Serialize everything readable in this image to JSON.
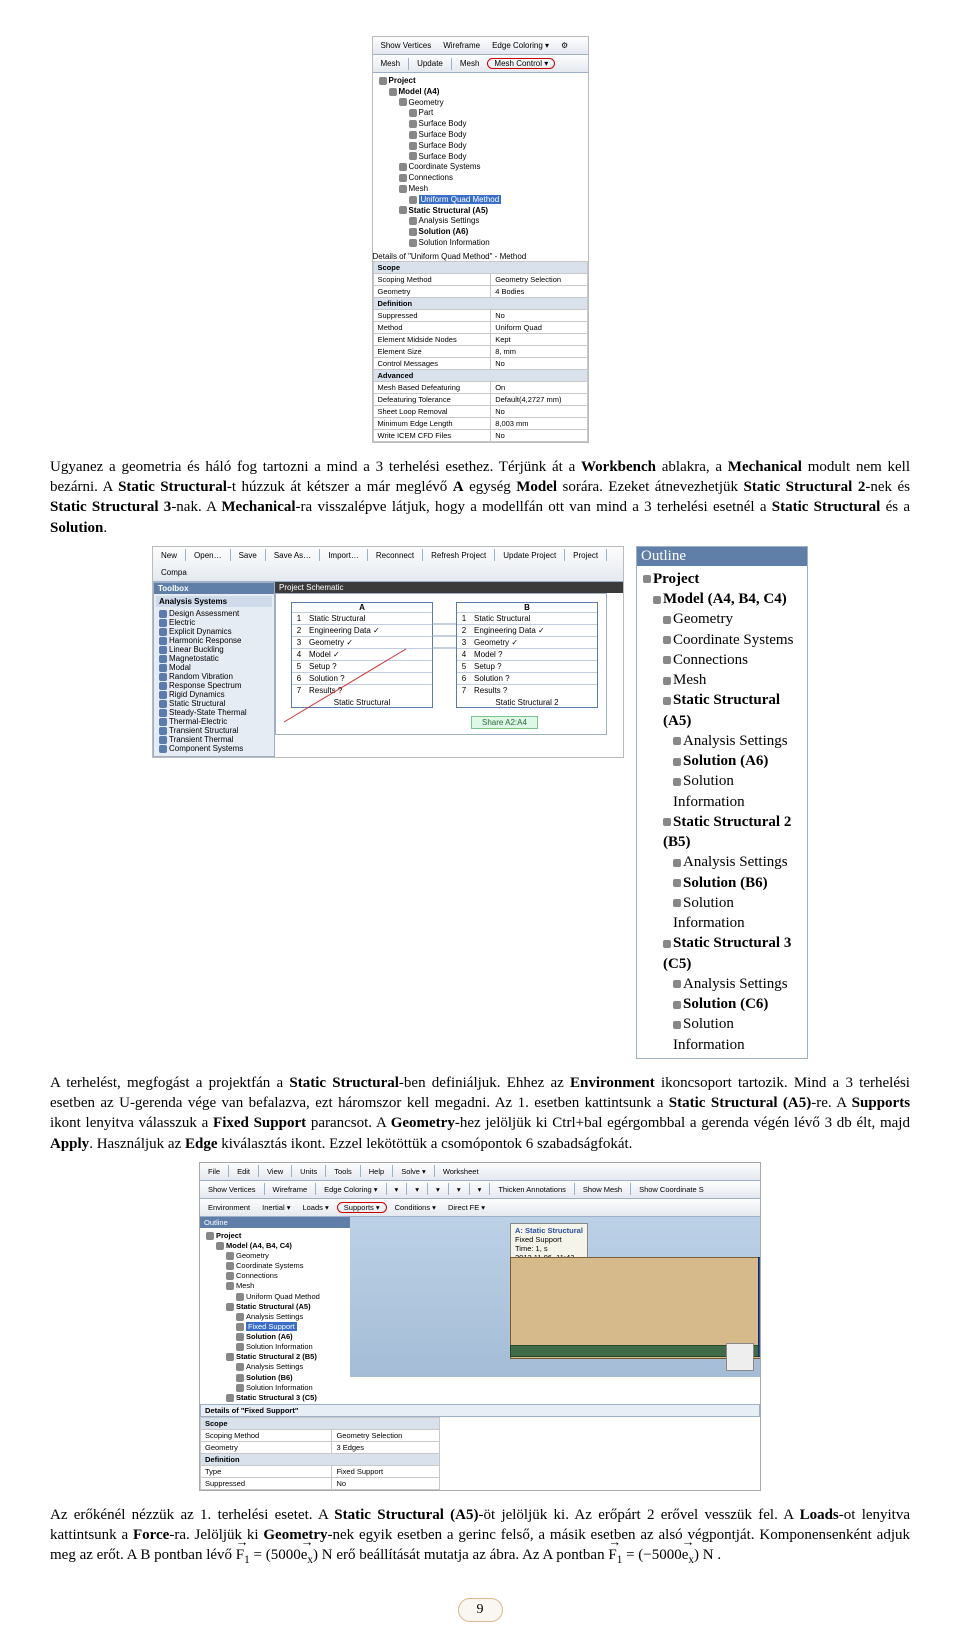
{
  "fig1": {
    "toolbar_row1": [
      "Show Vertices",
      "Wireframe",
      "Edge Coloring ▾",
      "⚙"
    ],
    "toolbar_row2": [
      "Mesh",
      "Update",
      "Mesh",
      "Mesh Control ▾"
    ],
    "tree_title": "Project",
    "tree": [
      {
        "lvl": 0,
        "txt": "Project",
        "bold": true
      },
      {
        "lvl": 1,
        "txt": "Model (A4)",
        "bold": true
      },
      {
        "lvl": 2,
        "txt": "Geometry"
      },
      {
        "lvl": 3,
        "txt": "Part"
      },
      {
        "lvl": 3,
        "txt": "Surface Body"
      },
      {
        "lvl": 3,
        "txt": "Surface Body"
      },
      {
        "lvl": 3,
        "txt": "Surface Body"
      },
      {
        "lvl": 3,
        "txt": "Surface Body"
      },
      {
        "lvl": 2,
        "txt": "Coordinate Systems"
      },
      {
        "lvl": 2,
        "txt": "Connections"
      },
      {
        "lvl": 2,
        "txt": "Mesh"
      },
      {
        "lvl": 3,
        "txt": "Uniform Quad Method",
        "sel": true
      },
      {
        "lvl": 2,
        "txt": "Static Structural (A5)",
        "bold": true
      },
      {
        "lvl": 3,
        "txt": "Analysis Settings"
      },
      {
        "lvl": 3,
        "txt": "Solution (A6)",
        "bold": true
      },
      {
        "lvl": 3,
        "txt": "Solution Information"
      }
    ],
    "detail_title": "Details of \"Uniform Quad Method\" - Method",
    "props": [
      {
        "hdr": "Scope"
      },
      {
        "k": "Scoping Method",
        "v": "Geometry Selection"
      },
      {
        "k": "Geometry",
        "v": "4 Bodies"
      },
      {
        "hdr": "Definition"
      },
      {
        "k": "Suppressed",
        "v": "No"
      },
      {
        "k": "Method",
        "v": "Uniform Quad"
      },
      {
        "k": "Element Midside Nodes",
        "v": "Kept"
      },
      {
        "k": "Element Size",
        "v": "8, mm"
      },
      {
        "k": "Control Messages",
        "v": "No"
      },
      {
        "hdr": "Advanced"
      },
      {
        "k": "Mesh Based Defeaturing",
        "v": "On"
      },
      {
        "k": "Defeaturing Tolerance",
        "v": "Default(4,2727 mm)"
      },
      {
        "k": "Sheet Loop Removal",
        "v": "No"
      },
      {
        "k": "Minimum Edge Length",
        "v": "8,003 mm"
      },
      {
        "k": "Write ICEM CFD Files",
        "v": "No"
      }
    ]
  },
  "para1_parts": {
    "a": "Ugyanez a geometria és háló fog tartozni a mind a 3 terhelési esethez. Térjünk át a ",
    "b": "Workbench",
    "c": " ablakra, a ",
    "d": "Mechanical",
    "e": " modult nem kell bezárni. A ",
    "f": "Static Structural",
    "g": "-t húzzuk át kétszer a már meglévő ",
    "h": "A",
    "i": " egység ",
    "j": "Model",
    "k": " sorára. Ezeket átnevezhetjük ",
    "l": "Static Structural 2",
    "m": "-nek és ",
    "n": "Static Structural 3",
    "o": "-nak. A ",
    "p": "Mechanical",
    "q": "-ra visszalépve látjuk, hogy a modellfán ott van mind a 3 terhelési esetnél a ",
    "r": "Static Structural",
    "s": " és a ",
    "t": "Solution",
    "u": "."
  },
  "fig2": {
    "toolbar": [
      "New",
      "Open…",
      "Save",
      "Save As…",
      "Import…",
      "Reconnect",
      "Refresh Project",
      "Update Project",
      "Project",
      "Compa"
    ],
    "toolbox_title": "Toolbox",
    "toolbox_group": "Analysis Systems",
    "toolbox_items": [
      "Design Assessment",
      "Electric",
      "Explicit Dynamics",
      "Harmonic Response",
      "Linear Buckling",
      "Magnetostatic",
      "Modal",
      "Random Vibration",
      "Response Spectrum",
      "Rigid Dynamics",
      "Static Structural",
      "Steady-State Thermal",
      "Thermal-Electric",
      "Transient Structural",
      "Transient Thermal",
      "Component Systems"
    ],
    "schematic_title": "Project Schematic",
    "cells": {
      "A": {
        "head": "A",
        "rows": [
          [
            "1",
            "Static Structural"
          ],
          [
            "2",
            "Engineering Data  ✓"
          ],
          [
            "3",
            "Geometry  ✓"
          ],
          [
            "4",
            "Model  ✓"
          ],
          [
            "5",
            "Setup  ?"
          ],
          [
            "6",
            "Solution  ?"
          ],
          [
            "7",
            "Results  ?"
          ]
        ],
        "cap": "Static Structural"
      },
      "B": {
        "head": "B",
        "rows": [
          [
            "1",
            "Static Structural"
          ],
          [
            "2",
            "Engineering Data  ✓"
          ],
          [
            "3",
            "Geometry  ✓"
          ],
          [
            "4",
            "Model  ?"
          ],
          [
            "5",
            "Setup  ?"
          ],
          [
            "6",
            "Solution  ?"
          ],
          [
            "7",
            "Results  ?"
          ]
        ],
        "cap": "Static Structural 2"
      }
    },
    "share_text": "Share A2:A4",
    "outline_title": "Outline",
    "outline": [
      {
        "lvl": 0,
        "txt": "Project",
        "bold": true
      },
      {
        "lvl": 1,
        "txt": "Model (A4, B4, C4)",
        "bold": true
      },
      {
        "lvl": 2,
        "txt": "Geometry"
      },
      {
        "lvl": 2,
        "txt": "Coordinate Systems"
      },
      {
        "lvl": 2,
        "txt": "Connections"
      },
      {
        "lvl": 2,
        "txt": "Mesh"
      },
      {
        "lvl": 2,
        "txt": "Static Structural (A5)",
        "bold": true
      },
      {
        "lvl": 3,
        "txt": "Analysis Settings"
      },
      {
        "lvl": 3,
        "txt": "Solution (A6)",
        "bold": true
      },
      {
        "lvl": 3,
        "txt": "Solution Information"
      },
      {
        "lvl": 2,
        "txt": "Static Structural 2 (B5)",
        "bold": true
      },
      {
        "lvl": 3,
        "txt": "Analysis Settings"
      },
      {
        "lvl": 3,
        "txt": "Solution (B6)",
        "bold": true
      },
      {
        "lvl": 3,
        "txt": "Solution Information"
      },
      {
        "lvl": 2,
        "txt": "Static Structural 3 (C5)",
        "bold": true
      },
      {
        "lvl": 3,
        "txt": "Analysis Settings"
      },
      {
        "lvl": 3,
        "txt": "Solution (C6)",
        "bold": true
      },
      {
        "lvl": 3,
        "txt": "Solution Information"
      }
    ]
  },
  "para2_parts": {
    "a": "A terhelést, megfogást a projektfán a ",
    "b": "Static Structural",
    "c": "-ben definiáljuk. Ehhez az ",
    "d": "Environment",
    "e": " ikoncsoport tartozik. Mind a 3 terhelési esetben az U-gerenda vége van befalazva, ezt háromszor kell megadni. Az 1. esetben kattintsunk a ",
    "f": "Static Structural (A5)",
    "g": "-re. A ",
    "h": "Supports",
    "i": " ikont lenyitva válasszuk a ",
    "j": "Fixed Support",
    "k": " parancsot. A ",
    "l": "Geometry",
    "m": "-hez jelöljük ki Ctrl+bal egérgombbal a gerenda végén lévő 3 db élt, majd ",
    "n": "Apply",
    "o": ". Használjuk az ",
    "p": "Edge",
    "q": " kiválasztás ikont. Ezzel lekötöttük a csomópontok 6 szabadságfokát."
  },
  "fig3": {
    "menu": [
      "File",
      "Edit",
      "View",
      "Units",
      "Tools",
      "Help",
      "Solve ▾",
      "Worksheet"
    ],
    "row1": [
      "Show Vertices",
      "Wireframe",
      "Edge Coloring ▾",
      "▾",
      "▾",
      "▾",
      "▾",
      "▾",
      "Thicken Annotations",
      "Show Mesh",
      "Show Coordinate S"
    ],
    "row2": [
      "Environment",
      "Inertial ▾",
      "Loads ▾",
      "Supports ▾",
      "Conditions ▾",
      "Direct FE ▾"
    ],
    "outline_title": "Outline",
    "outline": [
      {
        "lvl": 0,
        "txt": "Project",
        "bold": true
      },
      {
        "lvl": 1,
        "txt": "Model (A4, B4, C4)",
        "bold": true
      },
      {
        "lvl": 2,
        "txt": "Geometry"
      },
      {
        "lvl": 2,
        "txt": "Coordinate Systems"
      },
      {
        "lvl": 2,
        "txt": "Connections"
      },
      {
        "lvl": 2,
        "txt": "Mesh"
      },
      {
        "lvl": 3,
        "txt": "Uniform Quad Method"
      },
      {
        "lvl": 2,
        "txt": "Static Structural (A5)",
        "bold": true
      },
      {
        "lvl": 3,
        "txt": "Analysis Settings"
      },
      {
        "lvl": 3,
        "txt": "Fixed Support",
        "sel": true
      },
      {
        "lvl": 3,
        "txt": "Solution (A6)",
        "bold": true
      },
      {
        "lvl": 3,
        "txt": "Solution Information"
      },
      {
        "lvl": 2,
        "txt": "Static Structural 2 (B5)",
        "bold": true
      },
      {
        "lvl": 3,
        "txt": "Analysis Settings"
      },
      {
        "lvl": 3,
        "txt": "Solution (B6)",
        "bold": true
      },
      {
        "lvl": 3,
        "txt": "Solution Information"
      },
      {
        "lvl": 2,
        "txt": "Static Structural 3 (C5)",
        "bold": true
      },
      {
        "lvl": 3,
        "txt": "Analysis Settings"
      },
      {
        "lvl": 3,
        "txt": "Solution (C6)",
        "bold": true
      },
      {
        "lvl": 3,
        "txt": "Solution Information"
      }
    ],
    "legend": {
      "ttl": "A: Static Structural",
      "l2": "Fixed Support",
      "l3": "Time: 1, s",
      "l4": "2012.11.06. 11:42",
      "l5": "Fixed Support"
    },
    "detail_title": "Details of \"Fixed Support\"",
    "props": [
      {
        "hdr": "Scope"
      },
      {
        "k": "Scoping Method",
        "v": "Geometry Selection"
      },
      {
        "k": "Geometry",
        "v": "3 Edges"
      },
      {
        "hdr": "Definition"
      },
      {
        "k": "Type",
        "v": "Fixed Support"
      },
      {
        "k": "Suppressed",
        "v": "No"
      }
    ]
  },
  "para3_parts": {
    "a": "Az erőkénél nézzük az 1. terhelési esetet. A ",
    "b": "Static Structural (A5)",
    "c": "-öt jelöljük ki. Az erőpárt 2 erővel vesszük fel. A ",
    "d": "Loads",
    "e": "-ot lenyitva kattintsunk a ",
    "f": "Force",
    "g": "-ra. Jelöljük ki ",
    "h": "Geometry",
    "i": "-nek egyik esetben a gerinc felső, a másik esetben az alsó végpontját. Komponensenként adjuk meg az erőt. A B pontban lévő ",
    "eq1_pre": "F",
    "eq1_sub": "1",
    "eq1_val": " = (5000",
    "eq1_e": "e",
    "eq1_es": "x",
    "eq1_post": ") N",
    "j": " erő beállítását mutatja az ábra. Az A pontban ",
    "eq2_pre": "F",
    "eq2_sub": "1",
    "eq2_val": " = (−5000",
    "eq2_e": "e",
    "eq2_es": "x",
    "eq2_post": ") N",
    "k": "."
  },
  "page_number": "9"
}
